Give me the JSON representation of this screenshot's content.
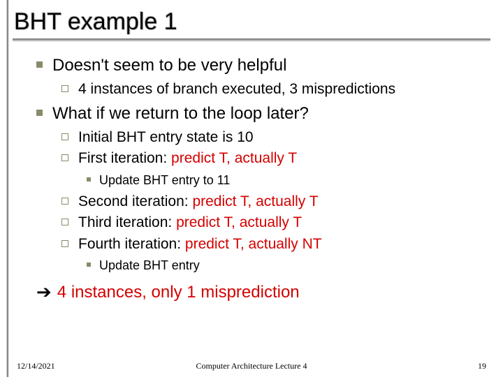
{
  "title": "BHT example 1",
  "b1a": "Doesn't seem to be very helpful",
  "b1a_sub": "4 instances of branch executed, 3 mispredictions",
  "b1b": "What if we return to the loop later?",
  "s_initial": "Initial BHT entry state is 10",
  "s_first_a": "First iteration:  ",
  "s_first_b": "predict T, actually T",
  "s_update11": "Update BHT entry to 11",
  "s_second_a": "Second iteration:  ",
  "s_second_b": "predict T, actually T",
  "s_third_a": "Third iteration:  ",
  "s_third_b": "predict T, actually T",
  "s_fourth_a": "Fourth iteration:  ",
  "s_fourth_b": "predict T, actually NT",
  "s_update": "Update BHT entry",
  "concl": "4 instances, only 1 misprediction",
  "footer": {
    "date": "12/14/2021",
    "center": "Computer Architecture Lecture 4",
    "page": "19"
  }
}
